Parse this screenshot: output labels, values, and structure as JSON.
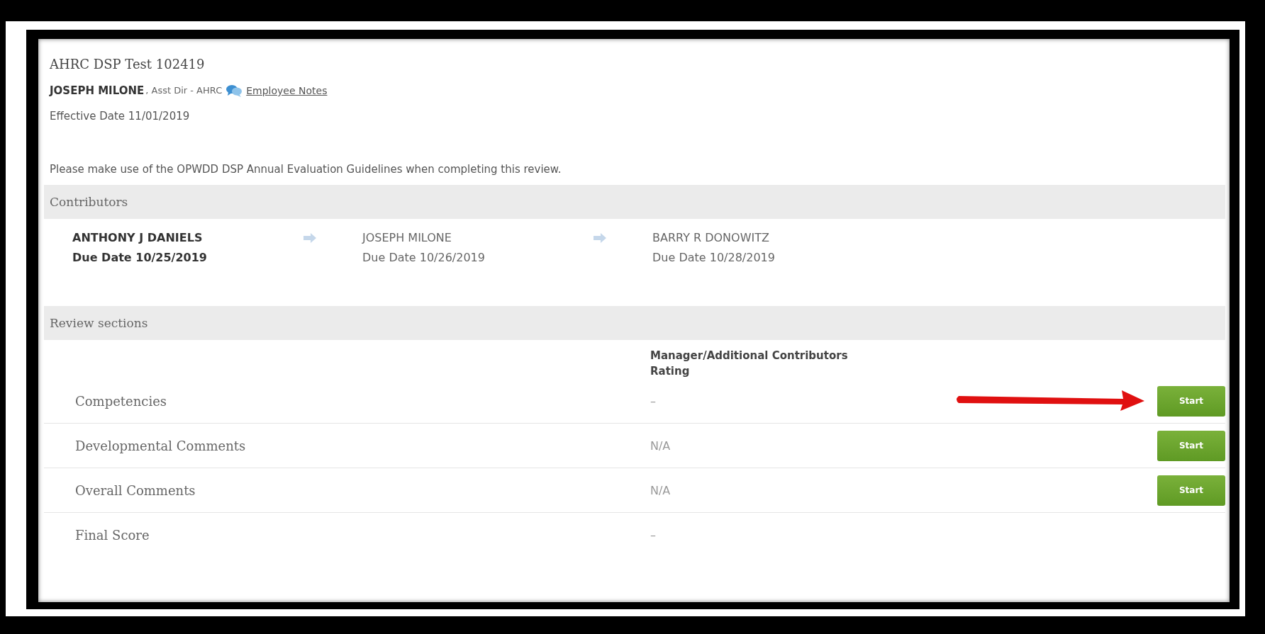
{
  "review": {
    "title": "AHRC DSP Test 102419",
    "employee_name": "JOSEPH MILONE",
    "employee_role": ", Asst Dir - AHRC",
    "notes_link": "Employee Notes",
    "effective_date": "Effective Date 11/01/2019",
    "instructions": "Please make use of the OPWDD DSP Annual Evaluation Guidelines when completing this review."
  },
  "contributors": {
    "heading": "Contributors",
    "items": [
      {
        "name": "ANTHONY J DANIELS",
        "due": "Due Date 10/25/2019",
        "current": true
      },
      {
        "name": "JOSEPH MILONE",
        "due": "Due Date 10/26/2019",
        "current": false
      },
      {
        "name": "BARRY R DONOWITZ",
        "due": "Due Date 10/28/2019",
        "current": false
      }
    ]
  },
  "review_sections": {
    "heading": "Review sections",
    "column_header": [
      "Manager/Additional Contributors",
      "Rating"
    ],
    "rows": [
      {
        "name": "Competencies",
        "rating": "–",
        "button": "Start",
        "annotated": true
      },
      {
        "name": "Developmental Comments",
        "rating": "N/A",
        "button": "Start",
        "annotated": false
      },
      {
        "name": "Overall Comments",
        "rating": "N/A",
        "button": "Start",
        "annotated": false
      },
      {
        "name": "Final Score",
        "rating": "–",
        "annotated": false
      }
    ]
  }
}
